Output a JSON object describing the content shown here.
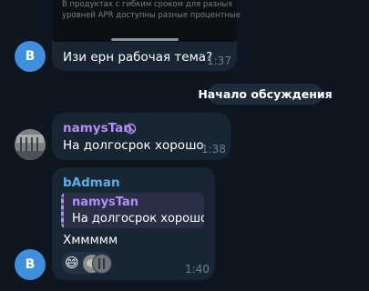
{
  "colors": {
    "background": "#0e1621",
    "bubble": "#182533",
    "avatar_b": "#3f8fdc",
    "name_namys": "#b48ff5",
    "name_badman": "#5eaee8",
    "time": "#6d7f8f"
  },
  "top_message": {
    "media_caption_line1": "В продуктах с гибким сроком для разных",
    "media_caption_line2": "уровней APR доступны разные процентные",
    "avatar_initial": "B",
    "text": "Изи ерн рабочая тема?",
    "time": "1:37"
  },
  "service_message": {
    "text": "Начало обсуждения"
  },
  "message_namys": {
    "author": "namysTan",
    "author_icon": "ban-circle-icon",
    "text": "На долгосрок хорошо",
    "time": "1:38"
  },
  "message_badman": {
    "author": "bAdman",
    "reply": {
      "author": "namysTan",
      "text": "На долгосрок хорошо"
    },
    "text": "Хммммм",
    "avatar_initial": "B",
    "time": "1:40",
    "reactions": {
      "emoji": "😄",
      "icon": "grinning-face-icon"
    }
  }
}
